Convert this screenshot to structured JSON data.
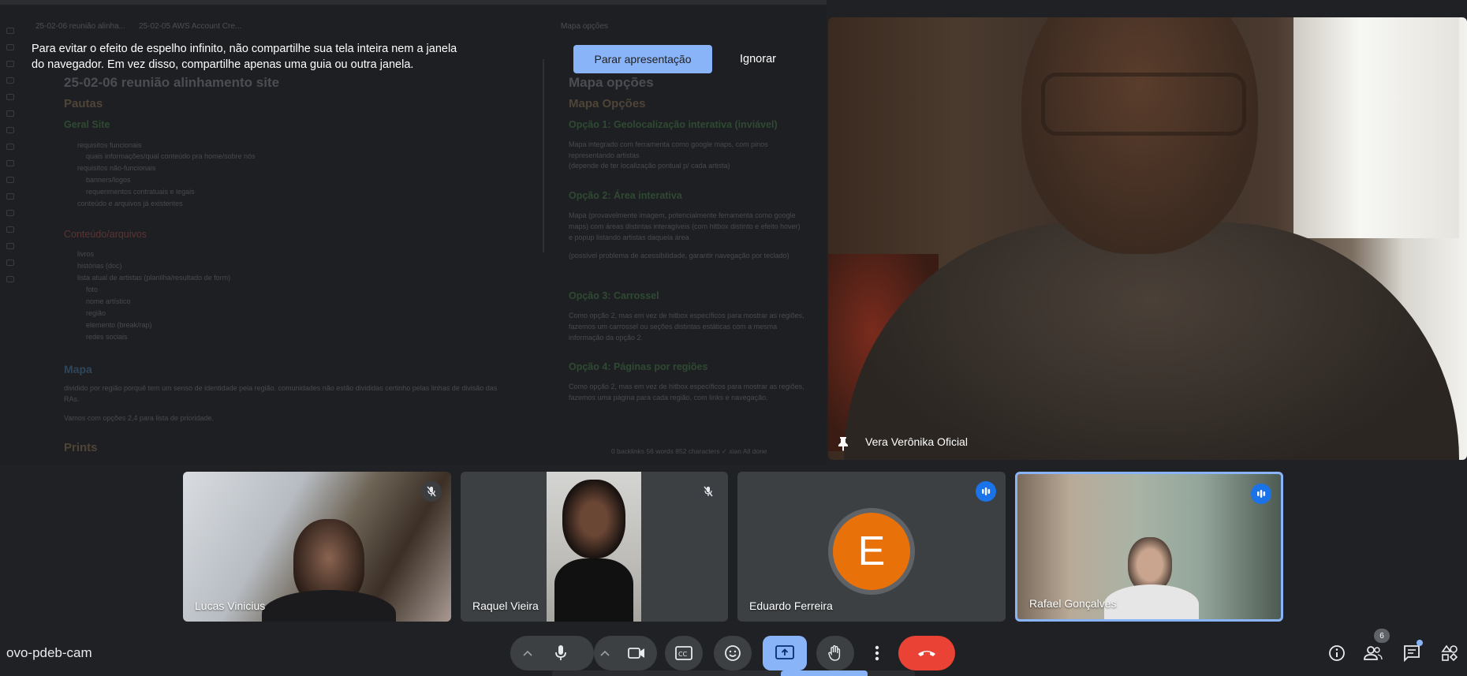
{
  "presentation": {
    "warning_line1": "Para evitar o efeito de espelho infinito, não compartilhe sua tela inteira nem a janela",
    "warning_line2": "do navegador. Em vez disso, compartilhe apenas uma guia ou outra janela.",
    "stop_label": "Parar apresentação",
    "ignore_label": "Ignorar",
    "left_doc": {
      "tab1": "25-02-06 reunião alinha...",
      "tab2": "25-02-05 AWS Account Cre...",
      "title": "25-02-06 reunião alinhamento site",
      "h_pautas": "Pautas",
      "h_geral": "Geral Site",
      "geral_items": [
        "requisitos funcionais",
        "quais informações/qual conteúdo pra home/sobre nós",
        "requisitos não-funcionais",
        "banners/logos",
        "requerimentos contratuais e legais",
        "conteúdo e arquivos já existentes"
      ],
      "h_conteudo": "Conteúdo/arquivos",
      "conteudo_items": [
        "livros",
        "histórias (doc)",
        "lista atual de artistas (planilha/resultado de form)",
        "foto",
        "nome artístico",
        "região",
        "elemento (break/rap)",
        "redes sociais"
      ],
      "h_mapa": "Mapa",
      "mapa_p1": "dividido por região porquê tem um senso de identidade pela região. comunidades não estão divididas certinho pelas linhas de divisão das RAs.",
      "mapa_p2": "Vamos com opções 2,4 para lista de prioridade.",
      "h_prints": "Prints"
    },
    "right_doc": {
      "tab": "Mapa opções",
      "title": "Mapa opções",
      "subtitle": "Mapa Opções",
      "op1_title": "Opção 1: Geolocalização interativa (inviável)",
      "op1_text": "Mapa integrado com ferramenta como google maps, com pinos representando artistas",
      "op1_note": "(depende de ter localização pontual p/ cada artista)",
      "op2_title": "Opção 2: Área interativa",
      "op2_text": "Mapa (provavelmente imagem, potencialmente ferramenta como google maps) com áreas distintas interagíveis (com hitbox distinto e efeito hover) e popup listando artistas daquela área",
      "op2_note": "(possível problema de acessibilidade, garantir navegação por teclado)",
      "op3_title": "Opção 3: Carrossel",
      "op3_text": "Como opção 2, mas em vez de hitbox específicos para mostrar as regiões, fazemos um carrossel ou seções distintas estáticas com a mesma informação da opção 2.",
      "op4_title": "Opção 4: Páginas por regiões",
      "op4_text": "Como opção 2, mas em vez de hitbox específicos para mostrar as regiões, fazemos uma página para cada região, com links e navegação.",
      "status": "0 backlinks   56 words  852 characters   ✓   xian   All done"
    }
  },
  "main_speaker": {
    "name": "Vera Verônika Oficial"
  },
  "participants": [
    {
      "name": "Lucas Vinicius",
      "muted": true
    },
    {
      "name": "Raquel Vieira",
      "muted": true
    },
    {
      "name": "Eduardo Ferreira",
      "avatar_letter": "E",
      "speaking": true
    },
    {
      "name": "Rafael Gonçalves",
      "speaking": true
    }
  ],
  "bottom_bar": {
    "meeting_code": "ovo-pdeb-cam",
    "people_count": "6",
    "icons": [
      "chevron-up-icon",
      "microphone-icon",
      "chevron-up-icon",
      "camera-icon",
      "captions-icon",
      "emoji-icon",
      "present-screen-icon",
      "raise-hand-icon",
      "more-options-icon",
      "leave-call-icon",
      "info-icon",
      "people-icon",
      "chat-icon",
      "activities-icon"
    ]
  },
  "colors": {
    "accent": "#8ab4f8",
    "leave": "#ea4335",
    "avatar": "#e8710a",
    "speaking": "#1a73e8",
    "background": "#202124"
  }
}
